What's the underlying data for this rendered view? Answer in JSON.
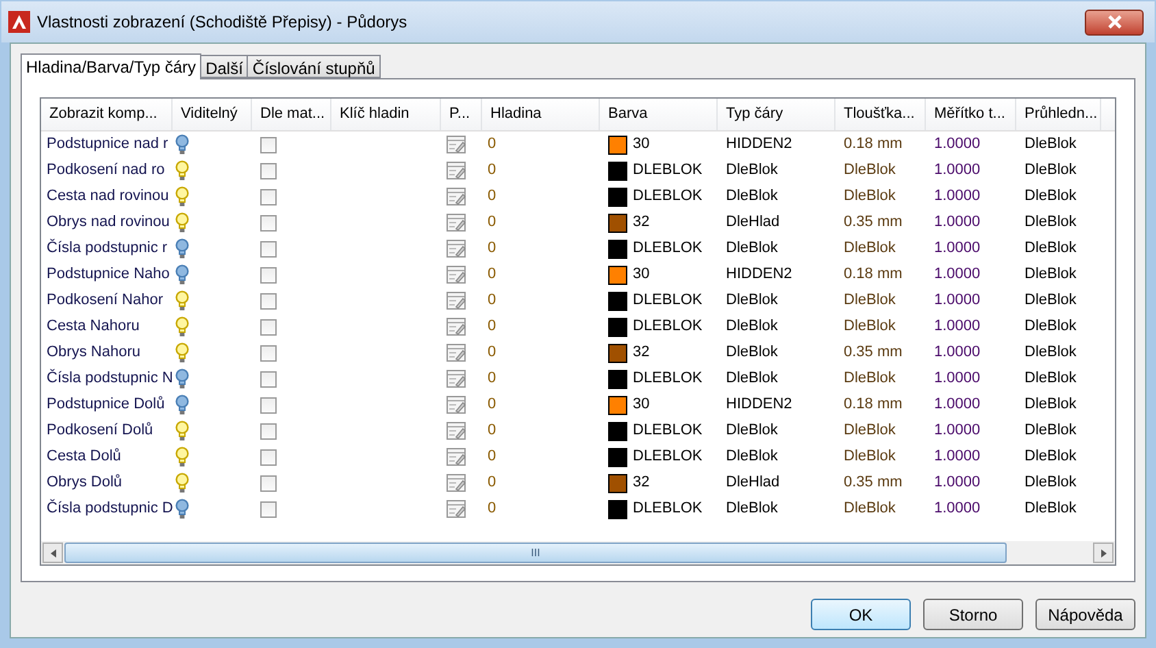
{
  "window": {
    "title": "Vlastnosti zobrazení (Schodiště Přepisy) - Půdorys"
  },
  "tabs": [
    {
      "label": "Hladina/Barva/Typ čáry",
      "selected": true
    },
    {
      "label": "Další",
      "selected": false
    },
    {
      "label": "Číslování stupňů",
      "selected": false
    }
  ],
  "table": {
    "columns": [
      "Zobrazit komp...",
      "Viditelný",
      "Dle mat...",
      "Klíč hladin",
      "P...",
      "Hladina",
      "Barva",
      "Typ čáry",
      "Tloušťka...",
      "Měřítko t...",
      "Průhledn..."
    ],
    "rows": [
      {
        "name": "Podstupnice nad r",
        "visible": false,
        "by_material": false,
        "layer": "0",
        "color": "#ff8000",
        "color_label": "30",
        "linetype": "HIDDEN2",
        "lineweight": "0.18 mm",
        "scale": "1.0000",
        "transparency": "DleBlok"
      },
      {
        "name": "Podkosení nad ro",
        "visible": true,
        "by_material": false,
        "layer": "0",
        "color": "#000000",
        "color_label": "DLEBLOK",
        "linetype": "DleBlok",
        "lineweight": "DleBlok",
        "scale": "1.0000",
        "transparency": "DleBlok"
      },
      {
        "name": "Cesta nad rovinou",
        "visible": true,
        "by_material": false,
        "layer": "0",
        "color": "#000000",
        "color_label": "DLEBLOK",
        "linetype": "DleBlok",
        "lineweight": "DleBlok",
        "scale": "1.0000",
        "transparency": "DleBlok"
      },
      {
        "name": "Obrys nad rovinou",
        "visible": true,
        "by_material": false,
        "layer": "0",
        "color": "#a05000",
        "color_label": "32",
        "linetype": "DleHlad",
        "lineweight": "0.35 mm",
        "scale": "1.0000",
        "transparency": "DleBlok"
      },
      {
        "name": "Čísla podstupnic r",
        "visible": false,
        "by_material": false,
        "layer": "0",
        "color": "#000000",
        "color_label": "DLEBLOK",
        "linetype": "DleBlok",
        "lineweight": "DleBlok",
        "scale": "1.0000",
        "transparency": "DleBlok"
      },
      {
        "name": "Podstupnice Naho",
        "visible": false,
        "by_material": false,
        "layer": "0",
        "color": "#ff8000",
        "color_label": "30",
        "linetype": "HIDDEN2",
        "lineweight": "0.18 mm",
        "scale": "1.0000",
        "transparency": "DleBlok"
      },
      {
        "name": "Podkosení Nahor",
        "visible": true,
        "by_material": false,
        "layer": "0",
        "color": "#000000",
        "color_label": "DLEBLOK",
        "linetype": "DleBlok",
        "lineweight": "DleBlok",
        "scale": "1.0000",
        "transparency": "DleBlok"
      },
      {
        "name": "Cesta Nahoru",
        "visible": true,
        "by_material": false,
        "layer": "0",
        "color": "#000000",
        "color_label": "DLEBLOK",
        "linetype": "DleBlok",
        "lineweight": "DleBlok",
        "scale": "1.0000",
        "transparency": "DleBlok"
      },
      {
        "name": "Obrys Nahoru",
        "visible": true,
        "by_material": false,
        "layer": "0",
        "color": "#a05000",
        "color_label": "32",
        "linetype": "DleBlok",
        "lineweight": "0.35 mm",
        "scale": "1.0000",
        "transparency": "DleBlok"
      },
      {
        "name": "Čísla podstupnic N",
        "visible": false,
        "by_material": false,
        "layer": "0",
        "color": "#000000",
        "color_label": "DLEBLOK",
        "linetype": "DleBlok",
        "lineweight": "DleBlok",
        "scale": "1.0000",
        "transparency": "DleBlok"
      },
      {
        "name": "Podstupnice Dolů",
        "visible": false,
        "by_material": false,
        "layer": "0",
        "color": "#ff8000",
        "color_label": "30",
        "linetype": "HIDDEN2",
        "lineweight": "0.18 mm",
        "scale": "1.0000",
        "transparency": "DleBlok"
      },
      {
        "name": "Podkosení Dolů",
        "visible": true,
        "by_material": false,
        "layer": "0",
        "color": "#000000",
        "color_label": "DLEBLOK",
        "linetype": "DleBlok",
        "lineweight": "DleBlok",
        "scale": "1.0000",
        "transparency": "DleBlok"
      },
      {
        "name": "Cesta Dolů",
        "visible": true,
        "by_material": false,
        "layer": "0",
        "color": "#000000",
        "color_label": "DLEBLOK",
        "linetype": "DleBlok",
        "lineweight": "DleBlok",
        "scale": "1.0000",
        "transparency": "DleBlok"
      },
      {
        "name": "Obrys Dolů",
        "visible": true,
        "by_material": false,
        "layer": "0",
        "color": "#a05000",
        "color_label": "32",
        "linetype": "DleHlad",
        "lineweight": "0.35 mm",
        "scale": "1.0000",
        "transparency": "DleBlok"
      },
      {
        "name": "Čísla podstupnic D",
        "visible": false,
        "by_material": false,
        "layer": "0",
        "color": "#000000",
        "color_label": "DLEBLOK",
        "linetype": "DleBlok",
        "lineweight": "DleBlok",
        "scale": "1.0000",
        "transparency": "DleBlok"
      }
    ]
  },
  "scrollbar_grip": "III",
  "buttons": [
    {
      "label": "OK",
      "default": true
    },
    {
      "label": "Storno",
      "default": false
    },
    {
      "label": "Nápověda",
      "default": false
    }
  ]
}
